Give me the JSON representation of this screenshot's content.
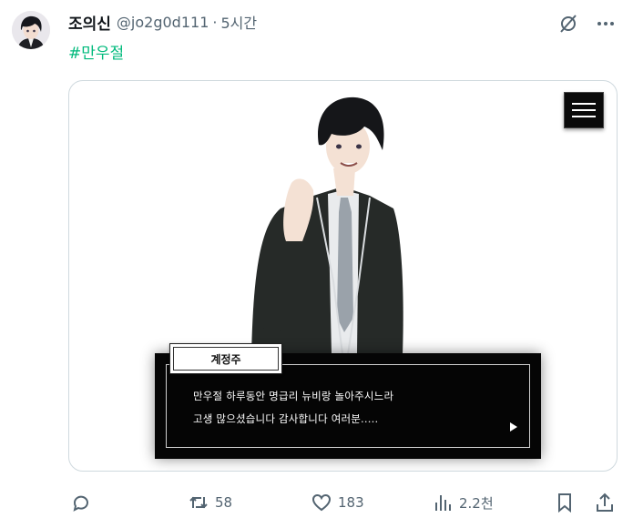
{
  "author": {
    "display_name": "조의신",
    "handle": "@jo2g0d111",
    "separator": "·",
    "time": "5시간"
  },
  "tweet": {
    "hashtag": "#만우절"
  },
  "game": {
    "speaker_name": "계정주",
    "dialog_lines": [
      "만우절 하루동안 명급리 뉴비랑 놀아주시느라",
      "고생 많으셨습니다 감사합니다 여러분....."
    ]
  },
  "actions": {
    "reply_count": "",
    "retweet_count": "58",
    "like_count": "183",
    "view_count": "2.2천"
  },
  "colors": {
    "hashtag": "#00ba7c",
    "secondary_text": "#536471",
    "dialog_bg": "#050505"
  },
  "icons": [
    "grok-icon",
    "more-icon",
    "menu-icon",
    "reply-icon",
    "retweet-icon",
    "like-icon",
    "views-icon",
    "bookmark-icon",
    "share-icon"
  ]
}
